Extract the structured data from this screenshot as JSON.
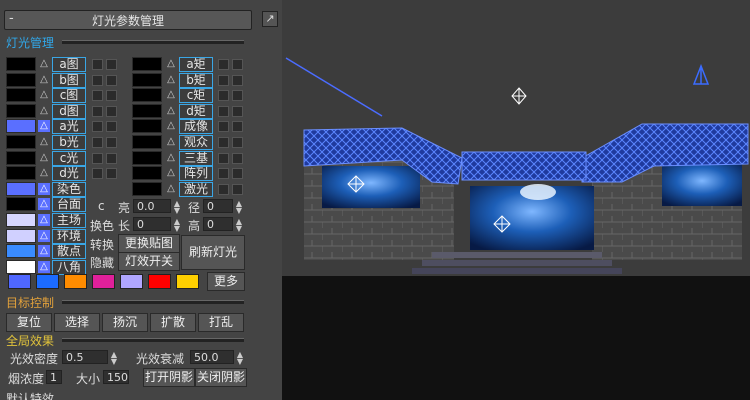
{
  "panel": {
    "title": "灯光参数管理",
    "minus": "-",
    "pin": "↗",
    "sections": {
      "light_mgmt": "灯光管理",
      "target": "目标控制",
      "global": "全局效果",
      "special": "默认特效"
    },
    "left_labels": [
      "a图",
      "b图",
      "c图",
      "d图",
      "a光",
      "b光",
      "c光",
      "d光",
      "染色",
      "台面",
      "主场",
      "环境",
      "散点",
      "八角"
    ],
    "left_swatches": [
      "#000000",
      "#000000",
      "#000000",
      "#000000",
      "#5a6fff",
      "#000000",
      "#000000",
      "#000000",
      "#5a6fff",
      "#000000",
      "#d6d6ff",
      "#d0d0ff",
      "#3a8bff",
      "#ffffff"
    ],
    "right_labels": [
      "a矩",
      "b矩",
      "c矩",
      "d矩",
      "成像",
      "观众",
      "三基",
      "阵列",
      "激光"
    ],
    "right_swatches": [
      "#000000",
      "#000000",
      "#000000",
      "#000000",
      "#000000",
      "#000000",
      "#000000",
      "#000000",
      "#000000"
    ],
    "tri": "△",
    "mid": {
      "c": "c",
      "liang": "亮",
      "liang_val": "0.0",
      "jing": "径",
      "jing_val": "0",
      "huanse": "换色",
      "chang": "长",
      "chang_val": "0",
      "gao": "高",
      "gao_val": "0",
      "zhuanhuan": "转换",
      "genghuan": "更换贴图",
      "yincang": "隐藏",
      "dengxiao": "灯效开关",
      "shuaxin": "刷新灯光"
    },
    "color_bar": [
      "#4f67ff",
      "#1c6bff",
      "#ff8c00",
      "#e0209a",
      "#b0a6ff",
      "#ff0000",
      "#ffd000"
    ],
    "more": "更多",
    "target_buttons": [
      "复位",
      "选择",
      "扬沉",
      "扩散",
      "打乱"
    ],
    "global": {
      "density_label": "光效密度",
      "density_val": "0.5",
      "decay_label": "光效衰减",
      "decay_val": "50.0",
      "smoke_label": "烟浓度",
      "smoke_val": "1",
      "size_label": "大小",
      "size_val": "150",
      "open_shadow": "打开阴影",
      "close_shadow": "关闭阴影"
    }
  }
}
